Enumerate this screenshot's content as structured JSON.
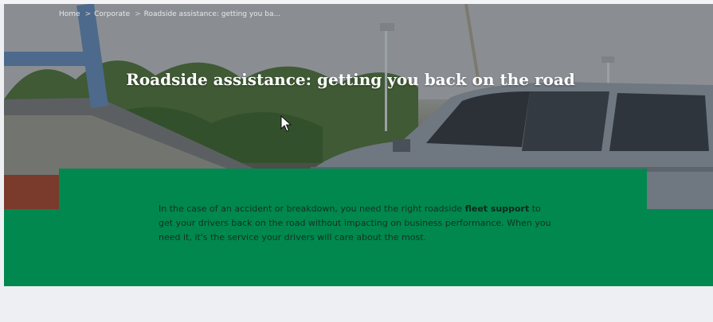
{
  "breadcrumb": {
    "items": [
      {
        "label": "Home"
      },
      {
        "label": "Corporate"
      },
      {
        "label": "Roadside assistance: getting you ba..."
      }
    ],
    "separator": ">"
  },
  "hero": {
    "title": "Roadside assistance: getting you back on the road"
  },
  "intro": {
    "text_before": "In the case of an accident or breakdown, you need the right roadside ",
    "link_text": "fleet support",
    "text_after": " to get your drivers back on the road without impacting on business performance. When you need it, it's the service your drivers will care about the most."
  },
  "colors": {
    "accent_green": "#00884f",
    "page_background": "#eeeff2",
    "title_text": "#ffffff"
  },
  "icons": {
    "cursor": "mouse-pointer-icon"
  }
}
